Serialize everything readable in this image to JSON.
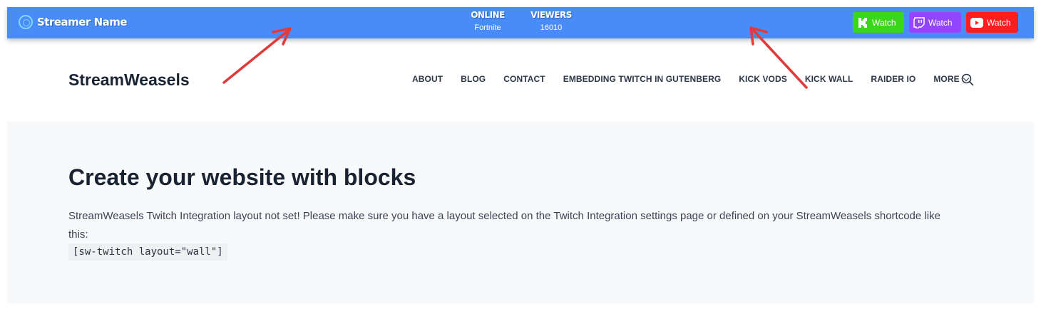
{
  "stream_bar": {
    "streamer_name": "Streamer Name",
    "online_label": "ONLINE",
    "online_value": "Fortnite",
    "viewers_label": "VIEWERS",
    "viewers_value": "16010",
    "buttons": [
      {
        "platform": "kick",
        "label": "Watch",
        "color": "#3ad618",
        "icon": "kick-icon"
      },
      {
        "platform": "twitch",
        "label": "Watch",
        "color": "#9146ff",
        "icon": "twitch-icon"
      },
      {
        "platform": "youtube",
        "label": "Watch",
        "color": "#ff1d1d",
        "icon": "youtube-icon"
      }
    ],
    "background_color": "#4a8cf7"
  },
  "header": {
    "logo": "StreamWeasels",
    "nav": [
      {
        "label": "ABOUT"
      },
      {
        "label": "BLOG"
      },
      {
        "label": "CONTACT"
      },
      {
        "label": "EMBEDDING TWITCH IN GUTENBERG"
      },
      {
        "label": "KICK VODS"
      },
      {
        "label": "KICK WALL"
      },
      {
        "label": "RAIDER IO"
      },
      {
        "label": "MORE"
      }
    ]
  },
  "main": {
    "title": "Create your website with blocks",
    "message": "StreamWeasels Twitch Integration layout not set! Please make sure you have a layout selected on the Twitch Integration settings page or defined on your StreamWeasels shortcode like this:",
    "shortcode": "[sw-twitch layout=\"wall\"]"
  },
  "annotations": {
    "arrow_color": "#e03a3a"
  }
}
